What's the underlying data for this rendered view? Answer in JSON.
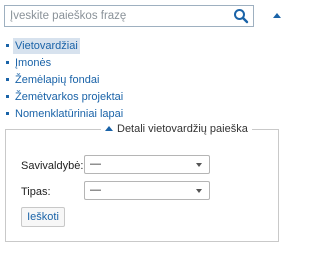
{
  "search": {
    "placeholder": "Įveskite paieškos frazę",
    "value": "",
    "icon": "search-icon"
  },
  "collapse_toggle": {
    "icon": "triangle-up-icon"
  },
  "results": {
    "items": [
      {
        "label": "Vietovardžiai",
        "active": true
      },
      {
        "label": "Įmonės",
        "active": false
      },
      {
        "label": "Žemėlapių fondai",
        "active": false
      },
      {
        "label": "Žemėtvarkos projektai",
        "active": false
      },
      {
        "label": "Nomenklatūriniai lapai",
        "active": false
      }
    ]
  },
  "details": {
    "legend": "Detali vietovardžių paieška",
    "legend_icon": "triangle-up-icon",
    "municipality_label": "Savivaldybė:",
    "municipality_value": "—",
    "type_label": "Tipas:",
    "type_value": "—",
    "submit_label": "Ieškoti"
  },
  "colors": {
    "accent": "#1a63a8",
    "active_bg": "#d7e2ee",
    "border": "#9eb0c0"
  }
}
